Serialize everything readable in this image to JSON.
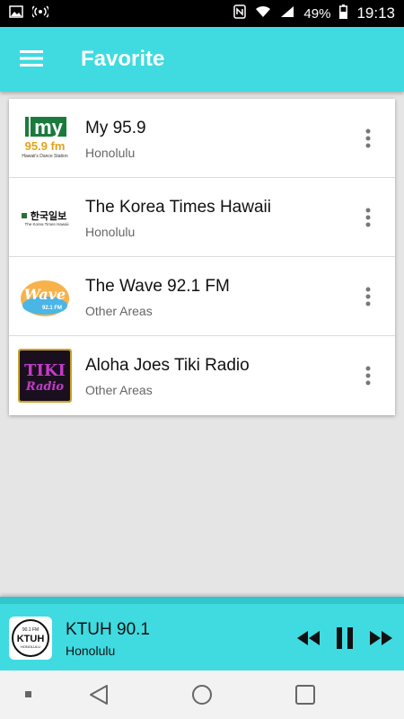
{
  "status_bar": {
    "battery": "49%",
    "time": "19:13",
    "icons": [
      "image-icon",
      "hotspot-icon",
      "nfc-icon",
      "wifi-icon",
      "signal-icon",
      "battery-icon"
    ]
  },
  "app_bar": {
    "title": "Favorite",
    "menu_icon": "hamburger-icon"
  },
  "stations": [
    {
      "name": "My 95.9",
      "location": "Honolulu",
      "logo": "my959-logo",
      "logo_text": {
        "brand": "my",
        "freq": "95.9 fm",
        "tagline": "Hawaii's Dance Station"
      }
    },
    {
      "name": "The Korea Times Hawaii",
      "location": "Honolulu",
      "logo": "korea-times-logo",
      "logo_text": {
        "brand": "한국일보",
        "tagline": "The Korea Times Hawaii"
      }
    },
    {
      "name": "The Wave 92.1 FM",
      "location": "Other Areas",
      "logo": "the-wave-logo",
      "logo_text": {
        "brand": "Wave",
        "freq": "92.1 FM"
      }
    },
    {
      "name": "Aloha Joes Tiki Radio",
      "location": "Other Areas",
      "logo": "tiki-radio-logo",
      "logo_text": {
        "brand": "TIKI",
        "sub": "Radio"
      }
    }
  ],
  "player": {
    "station": "KTUH 90.1",
    "location": "Honolulu",
    "logo_text": {
      "freq": "90.1 FM",
      "brand": "KTUH",
      "sub": "HONOLULU"
    },
    "controls": [
      "rewind-icon",
      "pause-icon",
      "fast-forward-icon"
    ]
  },
  "colors": {
    "accent": "#3fdbe0",
    "background": "#e5e5e5"
  }
}
